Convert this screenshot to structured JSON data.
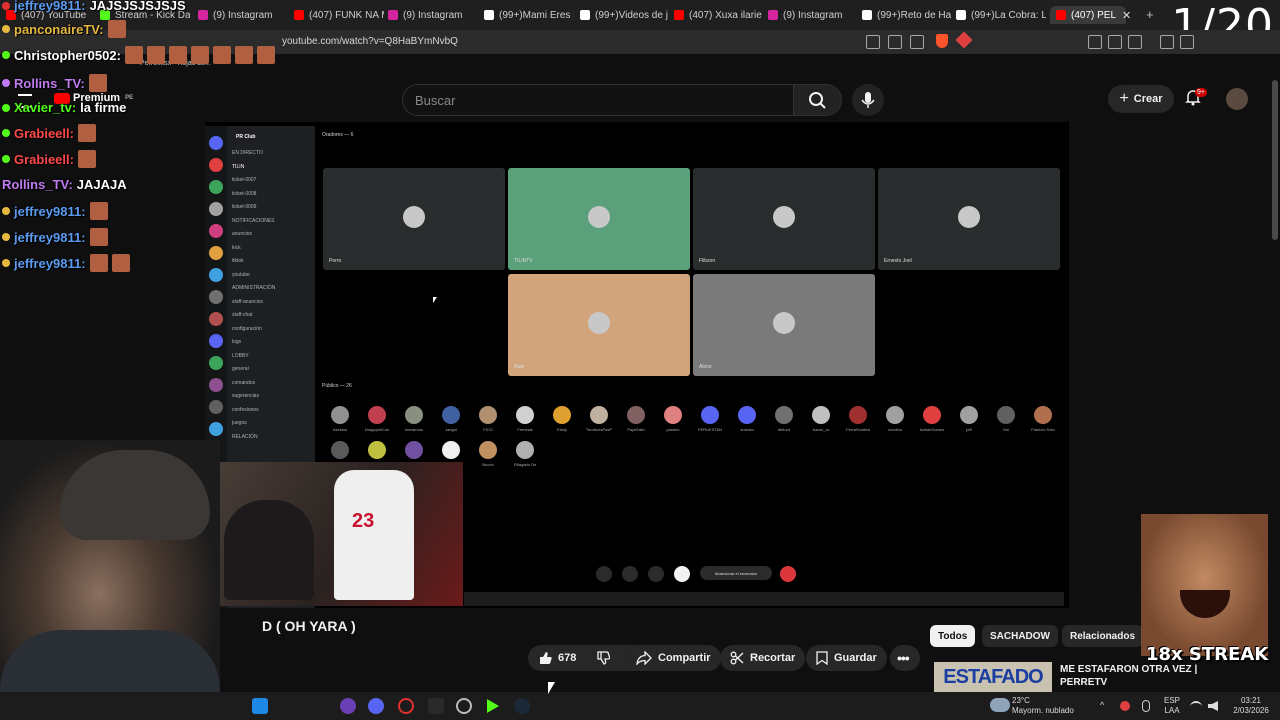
{
  "browser": {
    "tabs": [
      {
        "label": "(407) YouTube",
        "icon": "youtube-icon",
        "color": "#ff0000"
      },
      {
        "label": "Stream - Kick Da",
        "icon": "kick-icon",
        "color": "#53fc18"
      },
      {
        "label": "(9) Instagram",
        "icon": "instagram-icon",
        "color": "#d6249f"
      },
      {
        "label": "(407) FUNK NA M",
        "icon": "youtube-icon",
        "color": "#ff0000"
      },
      {
        "label": "(9) Instagram",
        "icon": "instagram-icon",
        "color": "#d6249f"
      },
      {
        "label": "(99+)Mami Eres L",
        "icon": "tiktok-icon",
        "color": "#ffffff"
      },
      {
        "label": "(99+)Videos de j",
        "icon": "tiktok-icon",
        "color": "#ffffff"
      },
      {
        "label": "(407) Xuxa ilarie",
        "icon": "youtube-icon",
        "color": "#ff0000"
      },
      {
        "label": "(9) Instagram",
        "icon": "instagram-icon",
        "color": "#d6249f"
      },
      {
        "label": "(99+)Reto de Ha",
        "icon": "tiktok-icon",
        "color": "#ffffff"
      },
      {
        "label": "(99+)La Cobra: L",
        "icon": "tiktok-icon",
        "color": "#ffffff"
      },
      {
        "label": "(407) PEL",
        "icon": "youtube-icon",
        "color": "#ff0000"
      }
    ],
    "url": "youtube.com/watch?v=Q8HaBYmNvbQ",
    "bookmark": "Perre.xlsx - Hojas de..."
  },
  "overlay_counter": "1/20",
  "youtube": {
    "logo_label": "Premium",
    "logo_region": "PE",
    "search_placeholder": "Buscar",
    "create_label": "Crear",
    "notif_count": "9+",
    "video_title_tail": "D ( OH YARA )",
    "likes": "678",
    "share_label": "Compartir",
    "clip_label": "Recortar",
    "save_label": "Guardar",
    "chips": [
      "Todos",
      "SACHADOW",
      "Relacionados"
    ],
    "rec_title": "ME ESTAFARON OTRA VEZ | PERRETV",
    "rec_thumb_text": "ESTAFADO"
  },
  "chat": [
    {
      "user": "jeffrey9811:",
      "text": "JAJSJSJSJSJS",
      "color": "#5b9bf0",
      "emotes": 0
    },
    {
      "user": "panconaireTV:",
      "text": "",
      "color": "#e6b840",
      "emotes": 1
    },
    {
      "user": "Christopher0502:",
      "text": "",
      "color": "#ffffff",
      "emotes": 7
    },
    {
      "user": "Rollins_TV:",
      "text": "",
      "color": "#bf7bf0",
      "emotes": 1
    },
    {
      "user": "Xavier_tv:",
      "text": "la firme",
      "color": "#53fc18",
      "emotes": 0
    },
    {
      "user": "Grabieell:",
      "text": "",
      "color": "#ff4a4a",
      "emotes": 1
    },
    {
      "user": "Grabieell:",
      "text": "",
      "color": "#ff4a4a",
      "emotes": 1
    },
    {
      "user": "Rollins_TV:",
      "text": "JAJAJA",
      "color": "#bf7bf0",
      "emotes": 0
    },
    {
      "user": "jeffrey9811:",
      "text": "",
      "color": "#5b9bf0",
      "emotes": 1
    },
    {
      "user": "jeffrey9811:",
      "text": "",
      "color": "#5b9bf0",
      "emotes": 1
    },
    {
      "user": "jeffrey9811:",
      "text": "",
      "color": "#5b9bf0",
      "emotes": 2
    }
  ],
  "discord": {
    "server": "PR Club",
    "stage_header": "Oradores — 6",
    "audience_header": "Público — 26",
    "leave_label": "Abandonar el escenario",
    "channels": [
      "EN DIRECTO",
      "TILIN",
      "ticket-0007",
      "ticket-0008",
      "ticket-0009",
      "NOTIFICACIONES",
      "anuncios",
      "kick",
      "tiktok",
      "youtube",
      "ADMINISTRACIÓN",
      "staff-anuncios",
      "staff-chat",
      "configuración",
      "logs",
      "LOBBY",
      "general",
      "comandos",
      "sugerencias",
      "confesiones",
      "juegos",
      "RELACIÓN"
    ],
    "speakers": [
      "Perro",
      "TILINTV",
      "Flibson",
      "Ernesto Joel",
      "Ruin",
      "Alone"
    ],
    "audience": [
      "Asesino",
      "DragopullCon",
      "Inerarmos",
      "Jangol",
      "FICO",
      "Frenesis",
      "Elmiy",
      "ToroAvesPasP",
      "PapiGallo",
      "pandex",
      "PERUKSTAN",
      "ernesto",
      "dfelord",
      "Aaron_xx",
      "PerraSombra",
      "cocofou",
      "AdrianGomez",
      "jeff",
      "Oni",
      "Fabricio Soto",
      "x",
      "x",
      "x",
      "x",
      "Bucoh",
      "Fillagado De"
    ]
  },
  "streak_text": "18x STREAK",
  "os": {
    "weather_temp": "23°C",
    "weather_text": "Mayorm. nublado",
    "lang": "ESP",
    "lang2": "LAA",
    "time": "03:21",
    "date": "2/03/2026"
  }
}
